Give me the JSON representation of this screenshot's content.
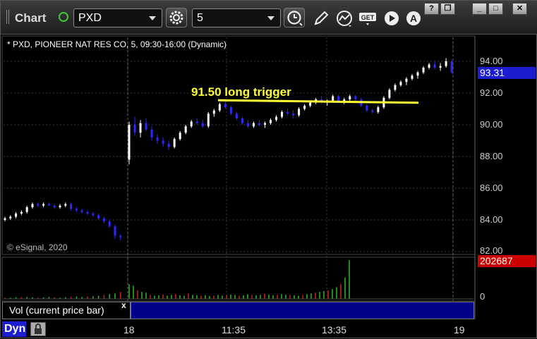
{
  "toolbar": {
    "title": "Chart",
    "symbol": "PXD",
    "interval": "5",
    "icons": [
      "gear-icon",
      "clock-icon",
      "pencil-icon",
      "study-icon",
      "get-icon",
      "play-icon",
      "alert-icon"
    ],
    "window_buttons": [
      "?",
      "❐",
      "_",
      "□",
      "✕"
    ]
  },
  "chart": {
    "description": "* PXD, PIONEER NAT RES CO, 5, 09:30-16:00 (Dynamic)",
    "copyright": "© eSignal, 2020",
    "annotation": "91.50 long trigger",
    "last_price": "93.31",
    "last_volume": "202687",
    "volume_zero_label": "0",
    "volume_legend": "Vol (current price bar)",
    "close_label": "x",
    "mode_label": "Dyn",
    "colors": {
      "up": "#ffffff",
      "down": "#2a2aff",
      "annotation_line": "#ffff33",
      "volume_up": "#2db82d",
      "volume_down": "#cc2222",
      "price_badge": "#1c1cd0",
      "volume_badge": "#cc0000"
    }
  },
  "chart_data": {
    "type": "candlestick",
    "y_ticks": [
      "94.00",
      "92.00",
      "90.00",
      "88.00",
      "86.00",
      "84.00",
      "82.00"
    ],
    "ylim": [
      82,
      94.5
    ],
    "x_ticks": [
      "18",
      "11:35",
      "13:35",
      "19"
    ],
    "annotation_level": 91.5,
    "candles_day1": [
      [
        84.0,
        84.2,
        83.9,
        84.1
      ],
      [
        84.1,
        84.3,
        84.0,
        84.2
      ],
      [
        84.2,
        84.5,
        84.1,
        84.4
      ],
      [
        84.4,
        84.6,
        84.3,
        84.5
      ],
      [
        84.5,
        84.9,
        84.4,
        84.8
      ],
      [
        84.8,
        85.1,
        84.7,
        85.0
      ],
      [
        85.0,
        85.1,
        84.8,
        84.9
      ],
      [
        84.9,
        85.1,
        84.8,
        85.0
      ],
      [
        85.0,
        85.1,
        84.9,
        84.9
      ],
      [
        84.9,
        85.0,
        84.7,
        84.8
      ],
      [
        84.8,
        85.0,
        84.7,
        84.9
      ],
      [
        84.9,
        85.1,
        84.8,
        85.0
      ],
      [
        85.0,
        85.1,
        84.6,
        84.7
      ],
      [
        84.7,
        84.8,
        84.5,
        84.6
      ],
      [
        84.6,
        84.7,
        84.4,
        84.5
      ],
      [
        84.5,
        84.6,
        84.3,
        84.4
      ],
      [
        84.4,
        84.5,
        84.2,
        84.3
      ],
      [
        84.3,
        84.4,
        84.0,
        84.1
      ],
      [
        84.1,
        84.2,
        83.8,
        83.9
      ],
      [
        83.9,
        84.0,
        83.5,
        83.6
      ],
      [
        83.6,
        83.7,
        82.8,
        83.0
      ],
      [
        83.0,
        83.1,
        82.7,
        82.9
      ]
    ],
    "candles_day2": [
      [
        87.8,
        90.2,
        87.5,
        90.0
      ],
      [
        90.0,
        90.5,
        89.3,
        89.5
      ],
      [
        89.5,
        90.3,
        89.2,
        90.1
      ],
      [
        90.1,
        90.4,
        89.6,
        89.7
      ],
      [
        89.7,
        89.9,
        89.0,
        89.2
      ],
      [
        89.2,
        89.4,
        88.8,
        89.0
      ],
      [
        89.0,
        89.2,
        88.6,
        88.8
      ],
      [
        88.8,
        89.0,
        88.4,
        88.6
      ],
      [
        88.6,
        89.2,
        88.5,
        89.1
      ],
      [
        89.1,
        89.6,
        89.0,
        89.5
      ],
      [
        89.5,
        90.0,
        89.4,
        89.9
      ],
      [
        89.9,
        90.3,
        89.8,
        90.2
      ],
      [
        90.2,
        90.4,
        90.0,
        90.1
      ],
      [
        90.1,
        90.3,
        89.8,
        89.9
      ],
      [
        89.9,
        90.8,
        89.8,
        90.7
      ],
      [
        90.7,
        91.0,
        90.5,
        90.9
      ],
      [
        90.9,
        91.4,
        90.8,
        91.3
      ],
      [
        91.3,
        91.5,
        91.0,
        91.1
      ],
      [
        91.1,
        91.2,
        90.6,
        90.7
      ],
      [
        90.7,
        90.8,
        90.3,
        90.4
      ],
      [
        90.4,
        90.5,
        90.0,
        90.1
      ],
      [
        90.1,
        90.3,
        89.8,
        89.9
      ],
      [
        89.9,
        90.2,
        89.8,
        90.1
      ],
      [
        90.1,
        90.3,
        89.9,
        90.0
      ],
      [
        90.0,
        90.2,
        89.8,
        90.1
      ],
      [
        90.1,
        90.4,
        90.0,
        90.3
      ],
      [
        90.3,
        90.6,
        90.2,
        90.5
      ],
      [
        90.5,
        90.9,
        90.4,
        90.8
      ],
      [
        90.8,
        91.0,
        90.6,
        90.7
      ],
      [
        90.7,
        90.9,
        90.4,
        90.6
      ],
      [
        90.6,
        91.1,
        90.5,
        91.0
      ],
      [
        91.0,
        91.3,
        90.9,
        91.2
      ],
      [
        91.2,
        91.5,
        91.1,
        91.4
      ],
      [
        91.4,
        91.7,
        91.3,
        91.6
      ],
      [
        91.6,
        91.8,
        91.3,
        91.4
      ],
      [
        91.4,
        91.6,
        91.2,
        91.5
      ],
      [
        91.5,
        91.9,
        91.4,
        91.8
      ],
      [
        91.8,
        91.9,
        91.4,
        91.5
      ],
      [
        91.5,
        91.7,
        91.3,
        91.6
      ],
      [
        91.6,
        91.9,
        91.4,
        91.8
      ],
      [
        91.8,
        91.9,
        91.5,
        91.6
      ],
      [
        91.6,
        91.7,
        91.1,
        91.2
      ],
      [
        91.2,
        91.3,
        90.8,
        90.9
      ],
      [
        90.9,
        91.0,
        90.7,
        90.8
      ],
      [
        90.8,
        91.2,
        90.7,
        91.1
      ],
      [
        91.1,
        91.8,
        91.0,
        91.7
      ],
      [
        91.7,
        92.3,
        91.6,
        92.2
      ],
      [
        92.2,
        92.6,
        92.1,
        92.5
      ],
      [
        92.5,
        92.8,
        92.4,
        92.7
      ],
      [
        92.7,
        93.0,
        92.5,
        92.9
      ],
      [
        92.9,
        93.2,
        92.8,
        93.1
      ],
      [
        93.1,
        93.4,
        92.9,
        93.3
      ],
      [
        93.3,
        93.7,
        93.2,
        93.6
      ],
      [
        93.6,
        93.9,
        93.5,
        93.8
      ],
      [
        93.8,
        94.0,
        93.5,
        93.6
      ],
      [
        93.6,
        93.9,
        93.4,
        93.7
      ],
      [
        93.7,
        94.2,
        93.6,
        94.0
      ],
      [
        94.0,
        94.1,
        93.2,
        93.31
      ]
    ],
    "volume": [
      3,
      3,
      4,
      4,
      5,
      4,
      3,
      4,
      5,
      4,
      3,
      4,
      5,
      6,
      5,
      6,
      7,
      8,
      10,
      12,
      14,
      18,
      38,
      34,
      22,
      18,
      16,
      10,
      8,
      9,
      11,
      8,
      10,
      12,
      9,
      8,
      14,
      10,
      9,
      8,
      9,
      7,
      8,
      10,
      8,
      9,
      11,
      10,
      8,
      9,
      12,
      10,
      9,
      10,
      13,
      11,
      9,
      10,
      12,
      11,
      10,
      9,
      8,
      10,
      12,
      14,
      16,
      18,
      20,
      22,
      25,
      30,
      38,
      55,
      100
    ],
    "volume_max": 202687
  }
}
